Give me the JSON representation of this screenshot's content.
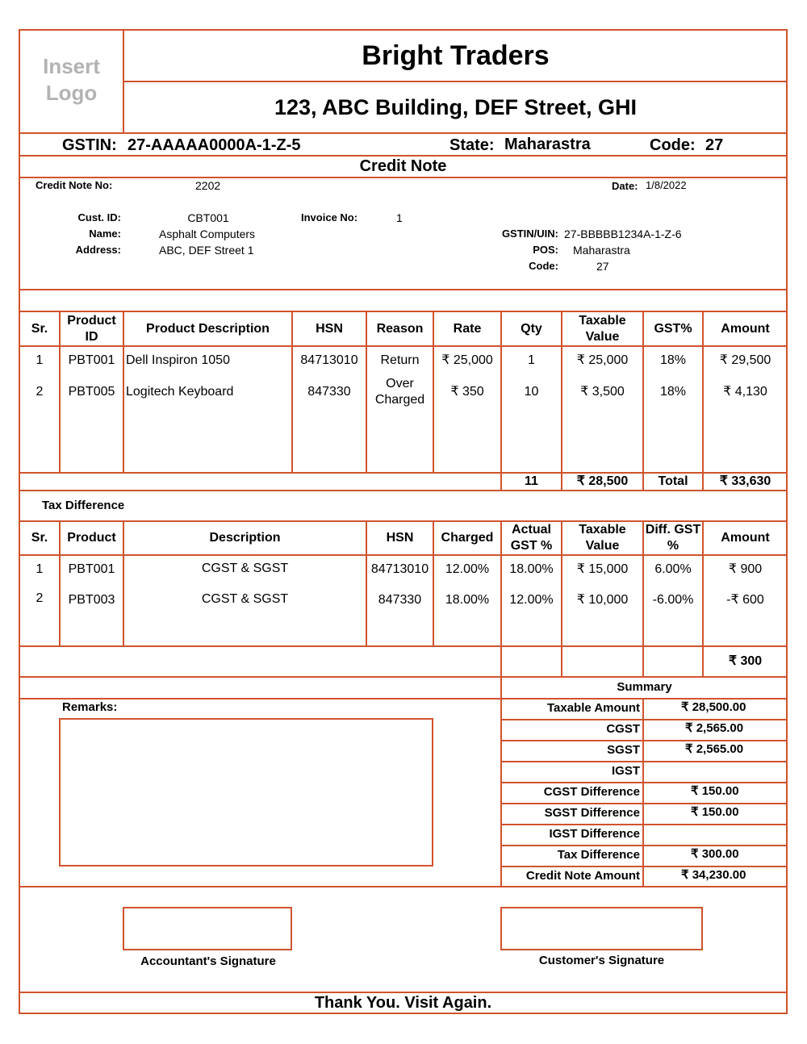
{
  "colors": {
    "border": "#d0532e",
    "logo_placeholder": "#b3b3b3",
    "text": "#000000"
  },
  "header": {
    "logo_placeholder": "Insert Logo",
    "company_name": "Bright Traders",
    "company_address": "123, ABC Building, DEF Street, GHI",
    "gstin_label": "GSTIN:",
    "gstin_value": "27-AAAAA0000A-1-Z-5",
    "state_label": "State:",
    "state_value": "Maharastra",
    "code_label": "Code:",
    "code_value": "27"
  },
  "document_title": "Credit Note",
  "meta": {
    "credit_note_no_label": "Credit Note No:",
    "credit_note_no": "2202",
    "date_label": "Date:",
    "date": "1/8/2022"
  },
  "customer": {
    "cust_id_label": "Cust. ID:",
    "cust_id": "CBT001",
    "invoice_no_label": "Invoice No:",
    "invoice_no": "1",
    "name_label": "Name:",
    "name": "Asphalt Computers",
    "address_label": "Address:",
    "address": "ABC, DEF Street 1",
    "gstin_label": "GSTIN/UIN:",
    "gstin": "27-BBBBB1234A-1-Z-6",
    "pos_label": "POS:",
    "pos": "Maharastra",
    "code_label": "Code:",
    "code": "27"
  },
  "items_table": {
    "headers": [
      "Sr.",
      "Product ID",
      "Product Description",
      "HSN",
      "Reason",
      "Rate",
      "Qty",
      "Taxable Value",
      "GST%",
      "Amount"
    ],
    "rows": [
      [
        "1",
        "PBT001",
        "Dell Inspiron 1050",
        "84713010",
        "Return",
        "₹ 25,000",
        "1",
        "₹ 25,000",
        "18%",
        "₹ 29,500"
      ],
      [
        "2",
        "PBT005",
        "Logitech Keyboard",
        "847330",
        "Over Charged",
        "₹ 350",
        "10",
        "₹ 3,500",
        "18%",
        "₹ 4,130"
      ]
    ],
    "totals": {
      "qty": "11",
      "taxable_value": "₹ 28,500",
      "total_label": "Total",
      "amount": "₹ 33,630"
    }
  },
  "tax_difference": {
    "title": "Tax Difference",
    "headers": [
      "Sr.",
      "Product",
      "Description",
      "HSN",
      "Charged",
      "Actual GST %",
      "Taxable Value",
      "Diff. GST %",
      "Amount"
    ],
    "rows": [
      [
        "1",
        "PBT001",
        "CGST & SGST",
        "84713010",
        "12.00%",
        "18.00%",
        "₹ 15,000",
        "6.00%",
        "₹ 900"
      ],
      [
        "2",
        "PBT003",
        "CGST & SGST",
        "847330",
        "18.00%",
        "12.00%",
        "₹ 10,000",
        "-6.00%",
        "-₹ 600"
      ]
    ],
    "total_amount": "₹ 300"
  },
  "remarks": {
    "label": "Remarks:",
    "value": ""
  },
  "summary": {
    "title": "Summary",
    "rows": [
      {
        "label": "Taxable Amount",
        "value": "₹ 28,500.00"
      },
      {
        "label": "CGST",
        "value": "₹ 2,565.00"
      },
      {
        "label": "SGST",
        "value": "₹ 2,565.00"
      },
      {
        "label": "IGST",
        "value": ""
      },
      {
        "label": "CGST Difference",
        "value": "₹ 150.00"
      },
      {
        "label": "SGST Difference",
        "value": "₹ 150.00"
      },
      {
        "label": "IGST Difference",
        "value": ""
      },
      {
        "label": "Tax Difference",
        "value": "₹ 300.00"
      },
      {
        "label": "Credit Note Amount",
        "value": "₹ 34,230.00"
      }
    ]
  },
  "signatures": {
    "accountant": "Accountant's Signature",
    "customer": "Customer's Signature"
  },
  "footer": "Thank You. Visit Again."
}
